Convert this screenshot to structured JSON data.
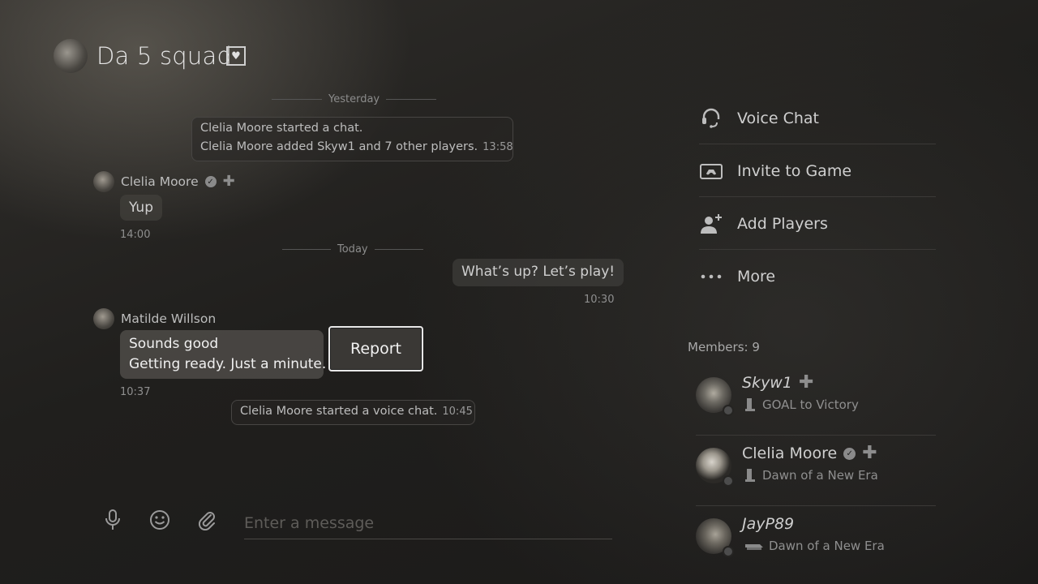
{
  "header": {
    "title": "Da 5 squad"
  },
  "messages": {
    "separator_yesterday": "Yesterday",
    "separator_today": "Today",
    "system1_line1": "Clelia Moore started a chat.",
    "system1_line2": "Clelia Moore added Skyw1 and 7 other players.",
    "system1_time": "13:58",
    "msg1_sender": "Clelia Moore",
    "msg1_text": "Yup",
    "msg1_time": "14:00",
    "msg2_text": "What’s up? Let’s play!",
    "msg2_time": "10:30",
    "msg3_sender": "Matilde Willson",
    "msg3_line1": "Sounds good",
    "msg3_line2": "Getting ready. Just a minute.",
    "msg3_time": "10:37",
    "system2_text": "Clelia Moore started a voice chat.",
    "system2_time": "10:45"
  },
  "context_menu": {
    "report_label": "Report"
  },
  "input": {
    "placeholder": "Enter a message"
  },
  "actions": {
    "voice_chat": "Voice Chat",
    "invite_to_game": "Invite to Game",
    "add_players": "Add Players",
    "more": "More"
  },
  "members": {
    "count_label": "Members: 9",
    "list": [
      {
        "name": "Skyw1",
        "game": "GOAL to Victory"
      },
      {
        "name": "Clelia Moore",
        "game": "Dawn of a New Era"
      },
      {
        "name": "JayP89",
        "game": "Dawn of a New Era"
      }
    ]
  },
  "icons": {
    "favorite": "heart-icon",
    "verified": "check-icon",
    "plus": "ps-plus-icon",
    "mic": "microphone-icon",
    "emoji": "smiley-icon",
    "attach": "paperclip-icon",
    "voice": "headset-icon",
    "invite": "game-invite-icon",
    "add": "add-person-icon",
    "more": "ellipsis-icon"
  },
  "colors": {
    "background": "#201f1d",
    "text": "#d8d8d8",
    "focus_border": "#e8e8e8"
  }
}
